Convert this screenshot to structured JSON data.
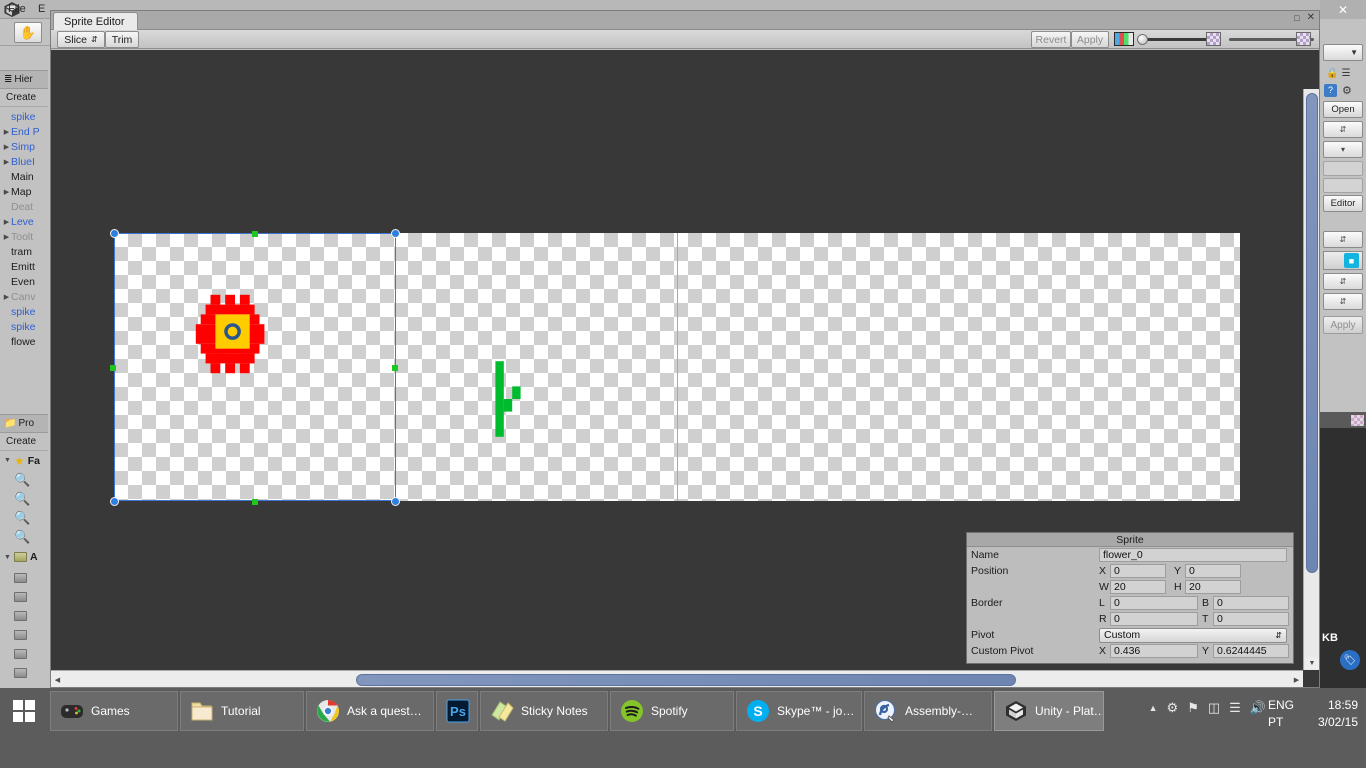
{
  "app": {
    "name": "Unity",
    "logo_icon": "unity-cube-icon"
  },
  "unity_menu": [
    "File",
    "E"
  ],
  "unity_toolbar": {
    "hand_tool_icon": "hand-tool-icon"
  },
  "hierarchy": {
    "tab_label": "Hier",
    "tab_icon": "hierarchy-icon",
    "create_label": "Create",
    "items": [
      {
        "label": "spike",
        "color": "blue",
        "arrow": false
      },
      {
        "label": "End P",
        "color": "blue",
        "arrow": true
      },
      {
        "label": "Simp",
        "color": "blue",
        "arrow": true
      },
      {
        "label": "BlueI",
        "color": "blue",
        "arrow": true
      },
      {
        "label": "Main",
        "color": "black",
        "arrow": false
      },
      {
        "label": "Map",
        "color": "black",
        "arrow": true
      },
      {
        "label": "Deat",
        "color": "gray",
        "arrow": false
      },
      {
        "label": "Leve",
        "color": "blue",
        "arrow": true
      },
      {
        "label": "Toolt",
        "color": "gray",
        "arrow": true
      },
      {
        "label": "tram",
        "color": "black",
        "arrow": false
      },
      {
        "label": "Emitt",
        "color": "black",
        "arrow": false
      },
      {
        "label": "Even",
        "color": "black",
        "arrow": false
      },
      {
        "label": "Canv",
        "color": "gray",
        "arrow": true
      },
      {
        "label": "spike",
        "color": "blue",
        "arrow": false
      },
      {
        "label": "spike",
        "color": "blue",
        "arrow": false
      },
      {
        "label": "flowe",
        "color": "black",
        "arrow": false
      }
    ]
  },
  "project": {
    "tab_label": "Pro",
    "tab_icon": "folder-icon",
    "create_label": "Create",
    "favorites_label": "Fa",
    "favorites_icon": "star-icon",
    "saved_searches": [
      "search-icon",
      "search-icon",
      "search-icon",
      "search-icon"
    ],
    "assets_label": "A",
    "assets_icon": "folder-open-icon",
    "asset_folders": [
      "folder-icon",
      "folder-icon",
      "folder-icon",
      "folder-icon",
      "folder-icon",
      "folder-icon"
    ]
  },
  "inspector": {
    "close_icon": "close-icon",
    "lock_icon": "lock-icon",
    "menu_icon": "menu-icon",
    "help_icon": "help-icon",
    "gear_icon": "gear-icon",
    "open_label": "Open",
    "editor_label": "Editor",
    "apply_label": "Apply",
    "sprite_icon": "sprite-thumbnail-icon",
    "preview_size_label": "KB",
    "tag_icon": "tag-icon"
  },
  "sprite_editor": {
    "window_title": "Sprite Editor",
    "maximize_icon": "maximize-icon",
    "close_icon": "close-icon",
    "toolbar": {
      "slice_label": "Slice",
      "slice_dropdown_icon": "chevron-updown-icon",
      "trim_label": "Trim",
      "revert_label": "Revert",
      "apply_label": "Apply",
      "rgb_swatch_icon": "rgb-channel-icon",
      "alpha_slider_value": 0,
      "checker_icon_left": "checker-icon",
      "zoom_slider_value": 0,
      "checker_icon_right": "checker-icon"
    },
    "sheet": {
      "cell_dividers": [
        281,
        563
      ],
      "sprites": [
        {
          "name": "flower",
          "art": "red-flower-pixel-art"
        },
        {
          "name": "plant",
          "art": "green-plant-pixel-art"
        }
      ]
    },
    "selection": {
      "handles_corner_icon": "resize-handle-circle",
      "handles_edge_icon": "resize-handle-square"
    },
    "panel": {
      "title": "Sprite",
      "name_label": "Name",
      "name_value": "flower_0",
      "position_label": "Position",
      "position": {
        "x_label": "X",
        "x": "0",
        "y_label": "Y",
        "y": "0",
        "w_label": "W",
        "w": "20",
        "h_label": "H",
        "h": "20"
      },
      "border_label": "Border",
      "border": {
        "l_label": "L",
        "l": "0",
        "b_label": "B",
        "b": "0",
        "r_label": "R",
        "r": "0",
        "t_label": "T",
        "t": "0"
      },
      "pivot_label": "Pivot",
      "pivot_value": "Custom",
      "pivot_dropdown_icon": "chevron-updown-icon",
      "custom_pivot_label": "Custom Pivot",
      "custom_pivot": {
        "x_label": "X",
        "x": "0.436",
        "y_label": "Y",
        "y": "0.6244445"
      }
    },
    "scrollbars": {
      "vertical_icon": "scrollbar-vertical",
      "horizontal_icon": "scrollbar-horizontal",
      "left_arrow_icon": "arrow-left-icon",
      "right_arrow_icon": "arrow-right-icon",
      "down_arrow_icon": "arrow-down-icon"
    }
  },
  "taskbar": {
    "start_icon": "windows-start-icon",
    "items": [
      {
        "label": "Games",
        "icon": "gamepad-icon",
        "active": false
      },
      {
        "label": "Tutorial",
        "icon": "folder-icon",
        "active": false
      },
      {
        "label": "Ask a quest…",
        "icon": "chrome-icon",
        "active": false
      },
      {
        "label": "",
        "icon": "photoshop-icon",
        "active": false
      },
      {
        "label": "Sticky Notes",
        "icon": "sticky-notes-icon",
        "active": false
      },
      {
        "label": "Spotify",
        "icon": "spotify-icon",
        "active": false
      },
      {
        "label": "Skype™ - jo…",
        "icon": "skype-icon",
        "active": false
      },
      {
        "label": "Assembly-…",
        "icon": "monodevelop-icon",
        "active": false
      },
      {
        "label": "Unity - Plat…",
        "icon": "unity-icon",
        "active": true
      }
    ],
    "tray": {
      "overflow_icon": "chevron-up-icon",
      "icons": [
        "settings-icon",
        "action-center-icon",
        "battery-icon",
        "network-icon",
        "volume-icon"
      ]
    },
    "language": {
      "line1": "ENG",
      "line2": "PT"
    },
    "clock": {
      "time": "18:59",
      "date": "3/02/15"
    }
  },
  "colors": {
    "accent_blue": "#3f76d6",
    "handle_green": "#1ec81e",
    "flower_red": "#ff0000",
    "flower_yellow": "#ffcc00",
    "plant_green": "#00bb2d",
    "scrollbar_blue": "#7488b5"
  }
}
